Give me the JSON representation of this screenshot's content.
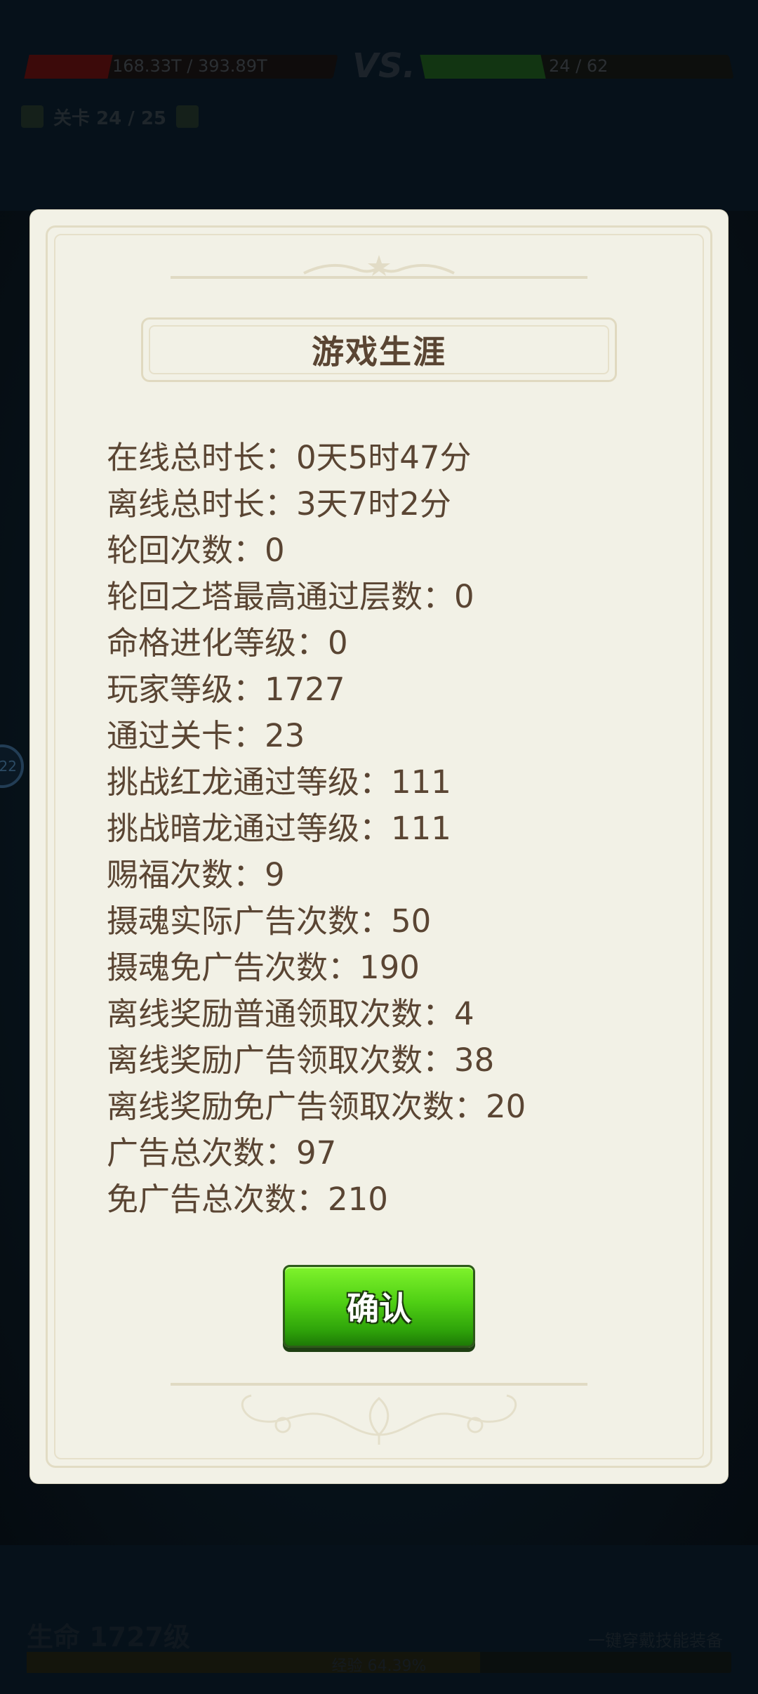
{
  "background": {
    "player_hp_text": "168.33T / 393.89T",
    "vs_label": "VS.",
    "enemy_hp_text": "24 / 62",
    "stage_label": "关卡 24 / 25",
    "side_badge": "22",
    "bottom_label": "生命 1727级",
    "bottom_right_text": "一键穿戴技能装备",
    "bottom_bar_text": "经验 64.39%",
    "player_hp_fraction": 0.27,
    "enemy_hp_fraction": 0.39,
    "exp_fraction": 0.6439
  },
  "modal": {
    "title": "游戏生涯",
    "stats": [
      "在线总时长：0天5时47分",
      "离线总时长：3天7时2分",
      "轮回次数：0",
      "轮回之塔最高通过层数：0",
      "命格进化等级：0",
      "玩家等级：1727",
      "通过关卡：23",
      "挑战红龙通过等级：111",
      "挑战暗龙通过等级：111",
      "赐福次数：9",
      "摄魂实际广告次数：50",
      "摄魂免广告次数：190",
      "离线奖励普通领取次数：4",
      "离线奖励广告领取次数：38",
      "离线奖励免广告领取次数：20",
      "广告总次数：97",
      "免广告总次数：210"
    ],
    "confirm_label": "确认"
  },
  "colors": {
    "panel": "#f2f1e6",
    "text": "#5a4533",
    "button_green": "#4fcf14"
  }
}
